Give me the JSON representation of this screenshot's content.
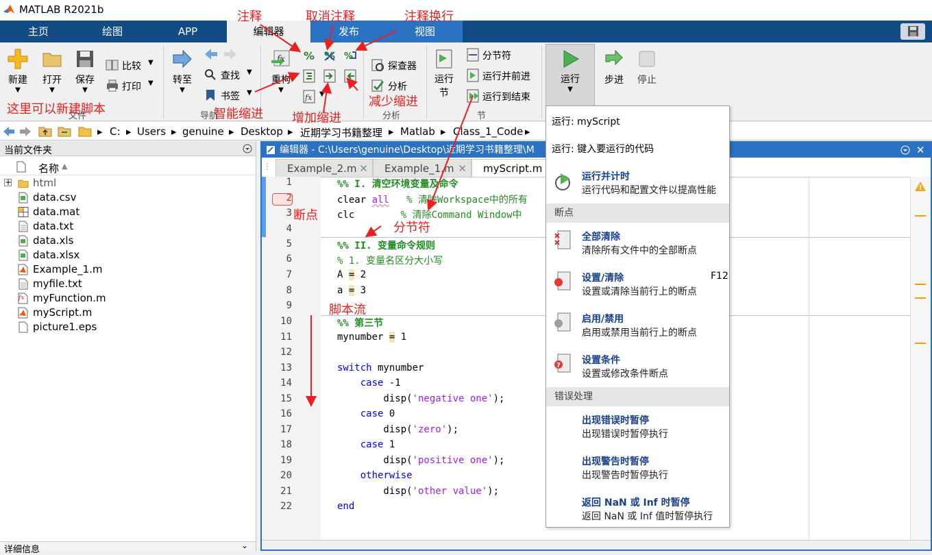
{
  "app": {
    "title": "MATLAB R2021b"
  },
  "tabs": [
    "主页",
    "绘图",
    "APP",
    "编辑器",
    "发布",
    "视图"
  ],
  "ribbon": {
    "new": "新建",
    "open": "打开",
    "save": "保存",
    "compare": "比较",
    "print": "打印",
    "goto": "转至",
    "find": "查找",
    "bookmark": "书签",
    "refactor": "重构",
    "inspector": "探查器",
    "analyze": "分析",
    "run_section": "运行节",
    "section_break": "分节符",
    "run_advance": "运行并前进",
    "run_to_end": "运行到结束",
    "run": "运行",
    "step": "步进",
    "stop": "停止",
    "group_file": "文件",
    "group_nav": "导航",
    "group_analysis": "分析",
    "group_section": "节"
  },
  "annotations": {
    "comment": "注释",
    "uncomment": "取消注释",
    "wrap_comment": "注释换行",
    "new_script": "这里可以新建脚本",
    "smart_indent": "智能缩进",
    "increase_indent": "增加缩进",
    "decrease_indent": "减少缩进",
    "breakpoint": "断点",
    "section_break": "分节符",
    "script_flow": "脚本流"
  },
  "path": [
    "C:",
    "Users",
    "genuine",
    "Desktop",
    "近期学习书籍整理",
    "Matlab",
    "Class_1_Code"
  ],
  "filebrowser": {
    "title": "当前文件夹",
    "column": "名称",
    "files": [
      "html",
      "data.csv",
      "data.mat",
      "data.txt",
      "data.xls",
      "data.xlsx",
      "Example_1.m",
      "myfile.txt",
      "myFunction.m",
      "myScript.m",
      "picture1.eps"
    ],
    "details": "详细信息"
  },
  "editor": {
    "title": "编辑器 - C:\\Users\\genuine\\Desktop\\近期学习书籍整理\\M",
    "tabs": [
      "Example_2.m",
      "Example_1.m",
      "myScript.m"
    ],
    "lines": [
      "1",
      "2",
      "3",
      "4",
      "5",
      "6",
      "7",
      "8",
      "9",
      "10",
      "11",
      "12",
      "13",
      "14",
      "15",
      "16",
      "17",
      "18",
      "19",
      "20",
      "21",
      "22"
    ]
  },
  "run_menu": {
    "run_script": "运行: myScript",
    "run_type": "运行: 键入要运行的代码",
    "timing_title": "运行并计时",
    "timing_desc": "运行代码和配置文件以提高性能",
    "section_breakpoints": "断点",
    "clear_all_title": "全部清除",
    "clear_all_desc": "清除所有文件中的全部断点",
    "set_clear_title": "设置/清除",
    "set_clear_shortcut": "F12",
    "set_clear_desc": "设置或清除当前行上的断点",
    "enable_title": "启用/禁用",
    "enable_desc": "启用或禁用当前行上的断点",
    "cond_title": "设置条件",
    "cond_desc": "设置或修改条件断点",
    "section_errors": "错误处理",
    "err_title": "出现错误时暂停",
    "err_desc": "出现错误时暂停执行",
    "warn_title": "出现警告时暂停",
    "warn_desc": "出现警告时暂停执行",
    "nan_title": "返回 NaN 或 Inf 时暂停",
    "nan_desc": "返回 NaN 或 Inf 值时暂停执行"
  }
}
